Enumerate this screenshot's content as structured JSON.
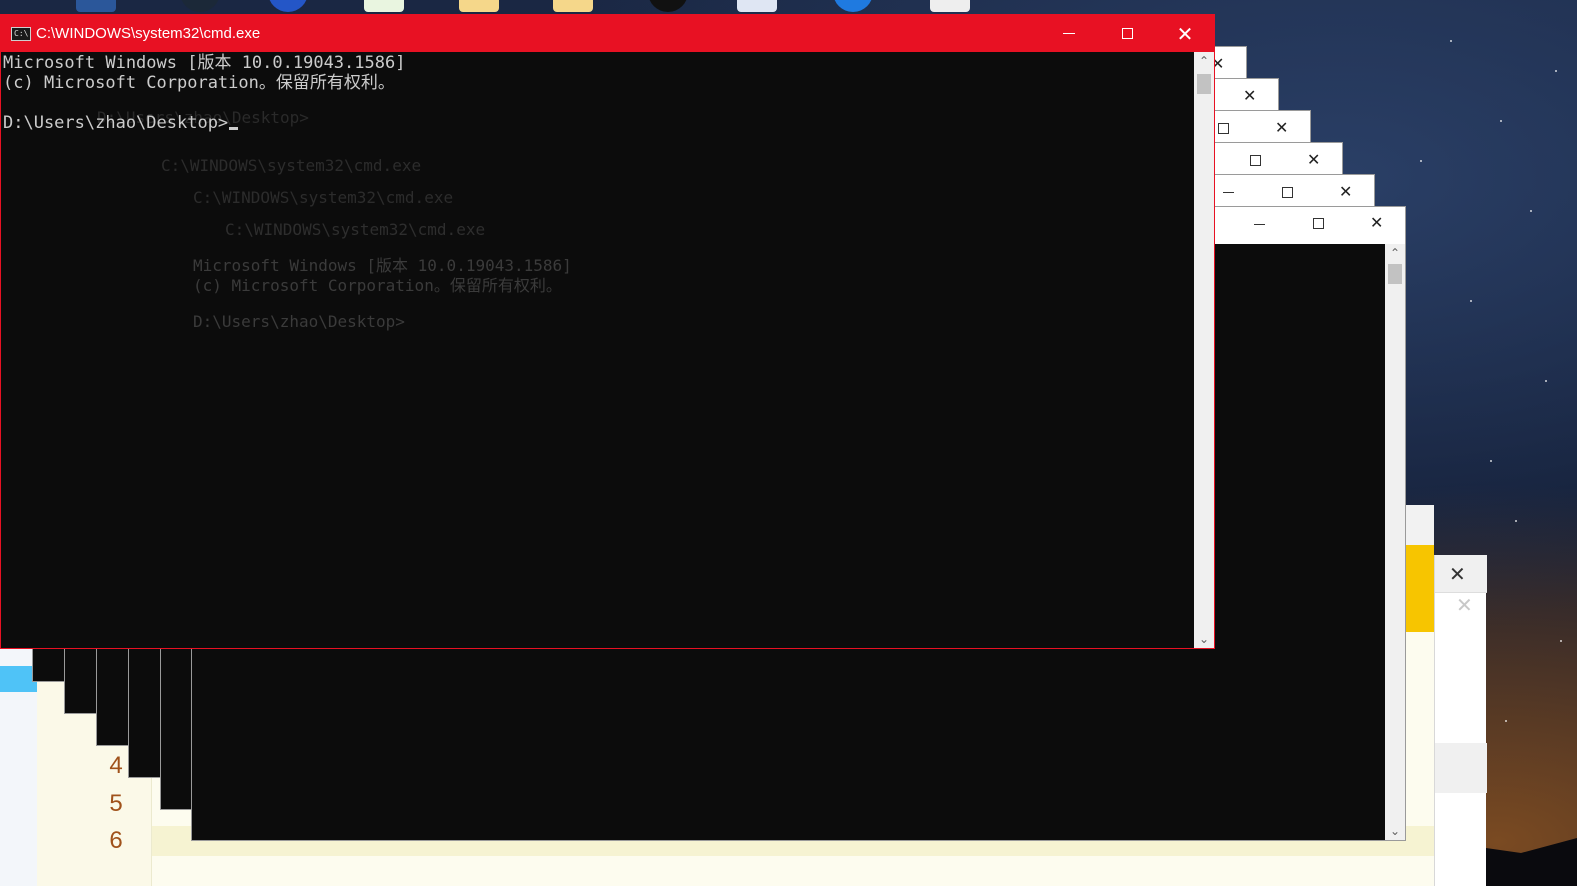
{
  "desktop": {
    "icons": [
      "word-doc-icon",
      "steam-icon",
      "user-app-icon",
      "media-player-icon",
      "folder-icon",
      "folder-icon",
      "qq-penguin-icon",
      "document-icon",
      "browser-icon",
      "blank-file-icon"
    ]
  },
  "main_window": {
    "title": "C:\\WINDOWS\\system32\\cmd.exe",
    "accent_color": "#e81123",
    "controls": {
      "minimize": "minimize",
      "maximize": "maximize",
      "close": "close"
    },
    "console_lines": [
      "Microsoft Windows [版本 10.0.19043.1586]",
      "(c) Microsoft Corporation。保留所有权利。",
      "",
      "D:\\Users\\zhao\\Desktop>"
    ]
  },
  "background_windows": {
    "ghost_title": "C:\\WINDOWS\\system32\\cmd.exe",
    "ghost_lines": [
      "Microsoft Windows [版本 10.0.19043.1586]",
      "(c) Microsoft Corporation。保留所有权利。",
      "D:\\Users\\zhao\\Desktop>"
    ]
  },
  "editor": {
    "line_numbers": [
      "4",
      "5",
      "6"
    ]
  }
}
